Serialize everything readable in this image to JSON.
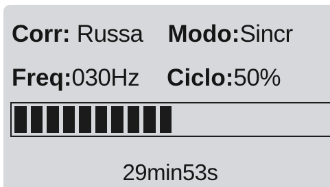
{
  "status_row_1": {
    "corr_label": "Corr:",
    "corr_value": " Russa",
    "modo_label": "Modo:",
    "modo_value": "Sincr"
  },
  "status_row_2": {
    "freq_label": "Freq:",
    "freq_value": "030Hz",
    "ciclo_label": "Ciclo:",
    "ciclo_value": "50%"
  },
  "progress": {
    "filled_segments": 10,
    "fraction": 0.55
  },
  "timer": {
    "remaining": "29min53s"
  },
  "colors": {
    "lcd_background": "#d7d8db",
    "lcd_text": "#151515",
    "segment": "#1b1b1b"
  }
}
